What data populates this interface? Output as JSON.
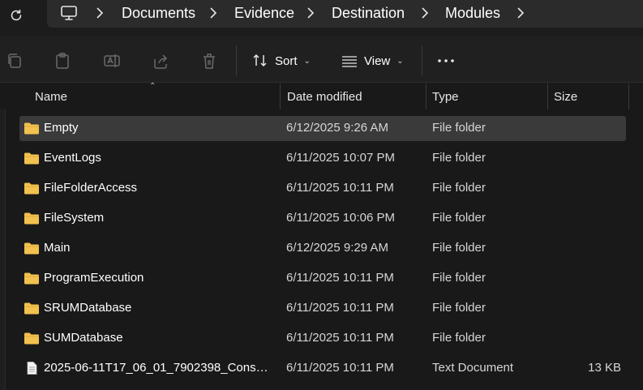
{
  "breadcrumb": {
    "items": [
      "Documents",
      "Evidence",
      "Destination",
      "Modules"
    ]
  },
  "toolbar": {
    "sort_label": "Sort",
    "view_label": "View"
  },
  "columns": {
    "name": "Name",
    "date": "Date modified",
    "type": "Type",
    "size": "Size"
  },
  "files": [
    {
      "name": "Empty",
      "date": "6/12/2025 9:26 AM",
      "type": "File folder",
      "size": "",
      "kind": "folder",
      "selected": true
    },
    {
      "name": "EventLogs",
      "date": "6/11/2025 10:07 PM",
      "type": "File folder",
      "size": "",
      "kind": "folder"
    },
    {
      "name": "FileFolderAccess",
      "date": "6/11/2025 10:11 PM",
      "type": "File folder",
      "size": "",
      "kind": "folder"
    },
    {
      "name": "FileSystem",
      "date": "6/11/2025 10:06 PM",
      "type": "File folder",
      "size": "",
      "kind": "folder"
    },
    {
      "name": "Main",
      "date": "6/12/2025 9:29 AM",
      "type": "File folder",
      "size": "",
      "kind": "folder"
    },
    {
      "name": "ProgramExecution",
      "date": "6/11/2025 10:11 PM",
      "type": "File folder",
      "size": "",
      "kind": "folder"
    },
    {
      "name": "SRUMDatabase",
      "date": "6/11/2025 10:11 PM",
      "type": "File folder",
      "size": "",
      "kind": "folder"
    },
    {
      "name": "SUMDatabase",
      "date": "6/11/2025 10:11 PM",
      "type": "File folder",
      "size": "",
      "kind": "folder"
    },
    {
      "name": "2025-06-11T17_06_01_7902398_ConsoleL...",
      "date": "6/11/2025 10:11 PM",
      "type": "Text Document",
      "size": "13 KB",
      "kind": "text"
    }
  ],
  "colors": {
    "folder": "#f2c14e",
    "background": "#191919",
    "selected_row": "#3a3a3a"
  }
}
